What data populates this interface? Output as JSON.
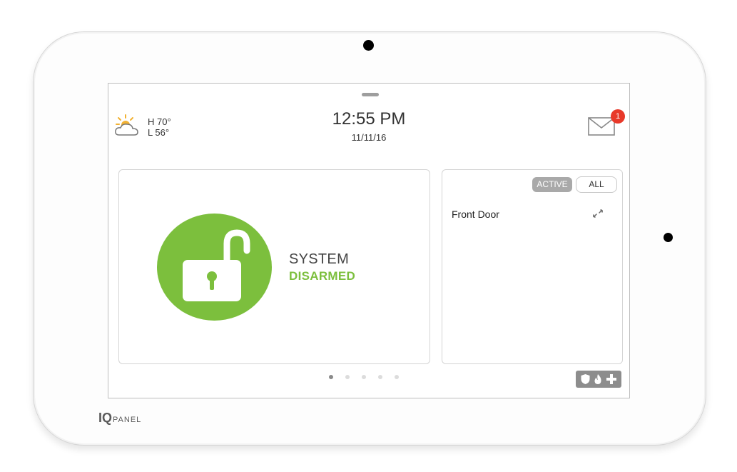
{
  "header": {
    "weather": {
      "high": "H 70°",
      "low": "L 56°",
      "icon": "partly-sunny-icon"
    },
    "time": "12:55 PM",
    "date": "11/11/16",
    "messages": {
      "icon": "mail-icon",
      "badge_count": "1"
    }
  },
  "status": {
    "line1": "SYSTEM",
    "line2": "DISARMED",
    "icon": "unlocked-padlock-icon",
    "colors": {
      "disarmed": "#7cbf3d"
    }
  },
  "sensors": {
    "filter_active": "ACTIVE",
    "filter_all": "ALL",
    "items": [
      {
        "name": "Front Door",
        "icon": "open-link-icon"
      }
    ]
  },
  "pager": {
    "pages": 5,
    "current": 1
  },
  "emergency": {
    "icons": [
      "shield-icon",
      "fire-icon",
      "medical-cross-icon"
    ]
  },
  "branding": {
    "logo_main": "IQ",
    "logo_sub": "PANEL"
  }
}
